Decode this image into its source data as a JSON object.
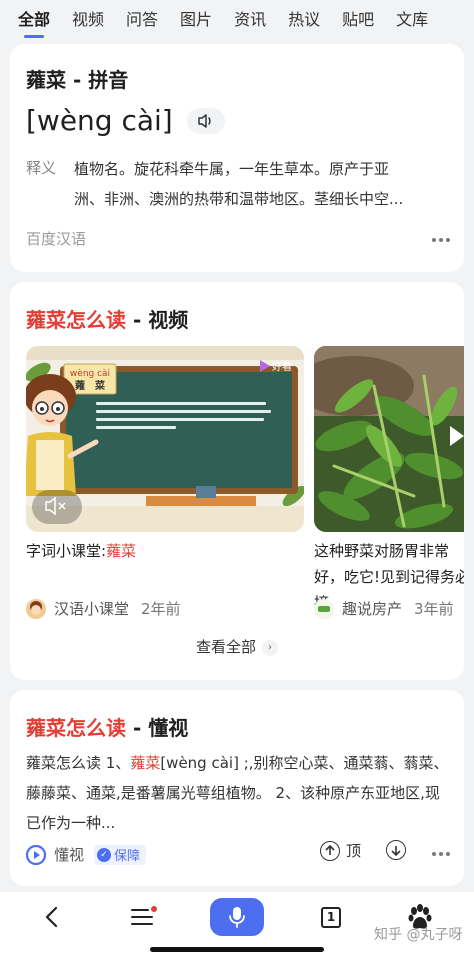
{
  "tabs": [
    {
      "label": "全部",
      "active": true
    },
    {
      "label": "视频"
    },
    {
      "label": "问答"
    },
    {
      "label": "图片"
    },
    {
      "label": "资讯"
    },
    {
      "label": "热议"
    },
    {
      "label": "贴吧"
    },
    {
      "label": "文库"
    }
  ],
  "dictionary_card": {
    "title": "蕹菜 - 拼音",
    "pinyin": "[wèng cài]",
    "definition_label": "释义",
    "definition_line1": "植物名。旋花科牵牛属，一年生草本。原产于亚",
    "definition_line2": "洲、非洲、澳洲的热带和温带地区。茎细长中空...",
    "source": "百度汉语"
  },
  "video_card": {
    "title_highlight": "蕹菜怎么读",
    "title_suffix": " - 视频",
    "videos": [
      {
        "title_prefix": "字词小课堂:",
        "title_highlight": "蕹菜",
        "author": "汉语小课堂",
        "age": "2年前",
        "thumb_pinyin": "wèng cài",
        "thumb_word": "蕹　菜",
        "thumb_watermark": "好看"
      },
      {
        "title": "这种野菜对肠胃非常好，吃它!见到记得务必摘",
        "author": "趣说房产",
        "age": "3年前"
      }
    ],
    "view_all": "查看全部"
  },
  "answer_card": {
    "title_highlight": "蕹菜怎么读",
    "title_suffix": " - 懂视",
    "text_a": "蕹菜怎么读 1、",
    "text_b": "蕹菜",
    "text_c": "[wèng cài]",
    "text_d": " ;,别称空心菜、通菜蓊、蓊菜、藤藤菜、通菜,是番薯属光萼组植物。 2、该种原产东亚地区,现已作为一种...",
    "source": "懂视",
    "badge": "保障",
    "action_top": "顶"
  },
  "bottom_bar": {
    "tab_count": "1",
    "watermark": "知乎 @丸子呀"
  },
  "colors": {
    "accent": "#4e6ef2",
    "highlight_red": "#e33e33"
  }
}
